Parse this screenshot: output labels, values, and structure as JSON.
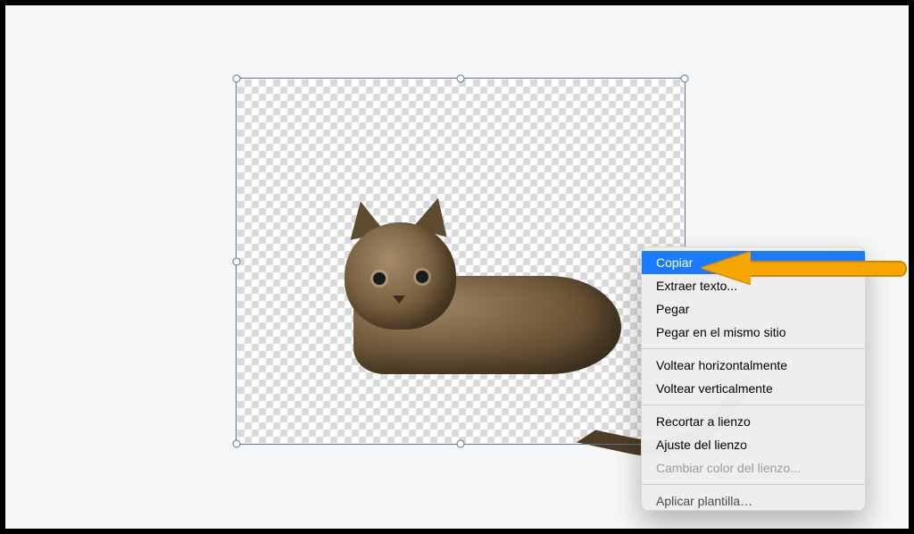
{
  "canvas": {
    "content_description": "tabby cat with background removed on transparent checkerboard",
    "selected": true
  },
  "context_menu": {
    "items": [
      {
        "label": "Copiar",
        "selected": true,
        "disabled": false
      },
      {
        "label": "Extraer texto...",
        "selected": false,
        "disabled": false
      },
      {
        "label": "Pegar",
        "selected": false,
        "disabled": false
      },
      {
        "label": "Pegar en el mismo sitio",
        "selected": false,
        "disabled": false
      },
      {
        "sep": true
      },
      {
        "label": "Voltear horizontalmente",
        "selected": false,
        "disabled": false
      },
      {
        "label": "Voltear verticalmente",
        "selected": false,
        "disabled": false
      },
      {
        "sep": true
      },
      {
        "label": "Recortar a lienzo",
        "selected": false,
        "disabled": false
      },
      {
        "label": "Ajuste del lienzo",
        "selected": false,
        "disabled": false
      },
      {
        "label": "Cambiar color del lienzo...",
        "selected": false,
        "disabled": true
      },
      {
        "sep": true
      },
      {
        "label": "Aplicar plantilla…",
        "selected": false,
        "disabled": false,
        "cut": true
      }
    ]
  },
  "annotation": {
    "arrow_target": "Copiar",
    "arrow_color": "#f6a602"
  }
}
